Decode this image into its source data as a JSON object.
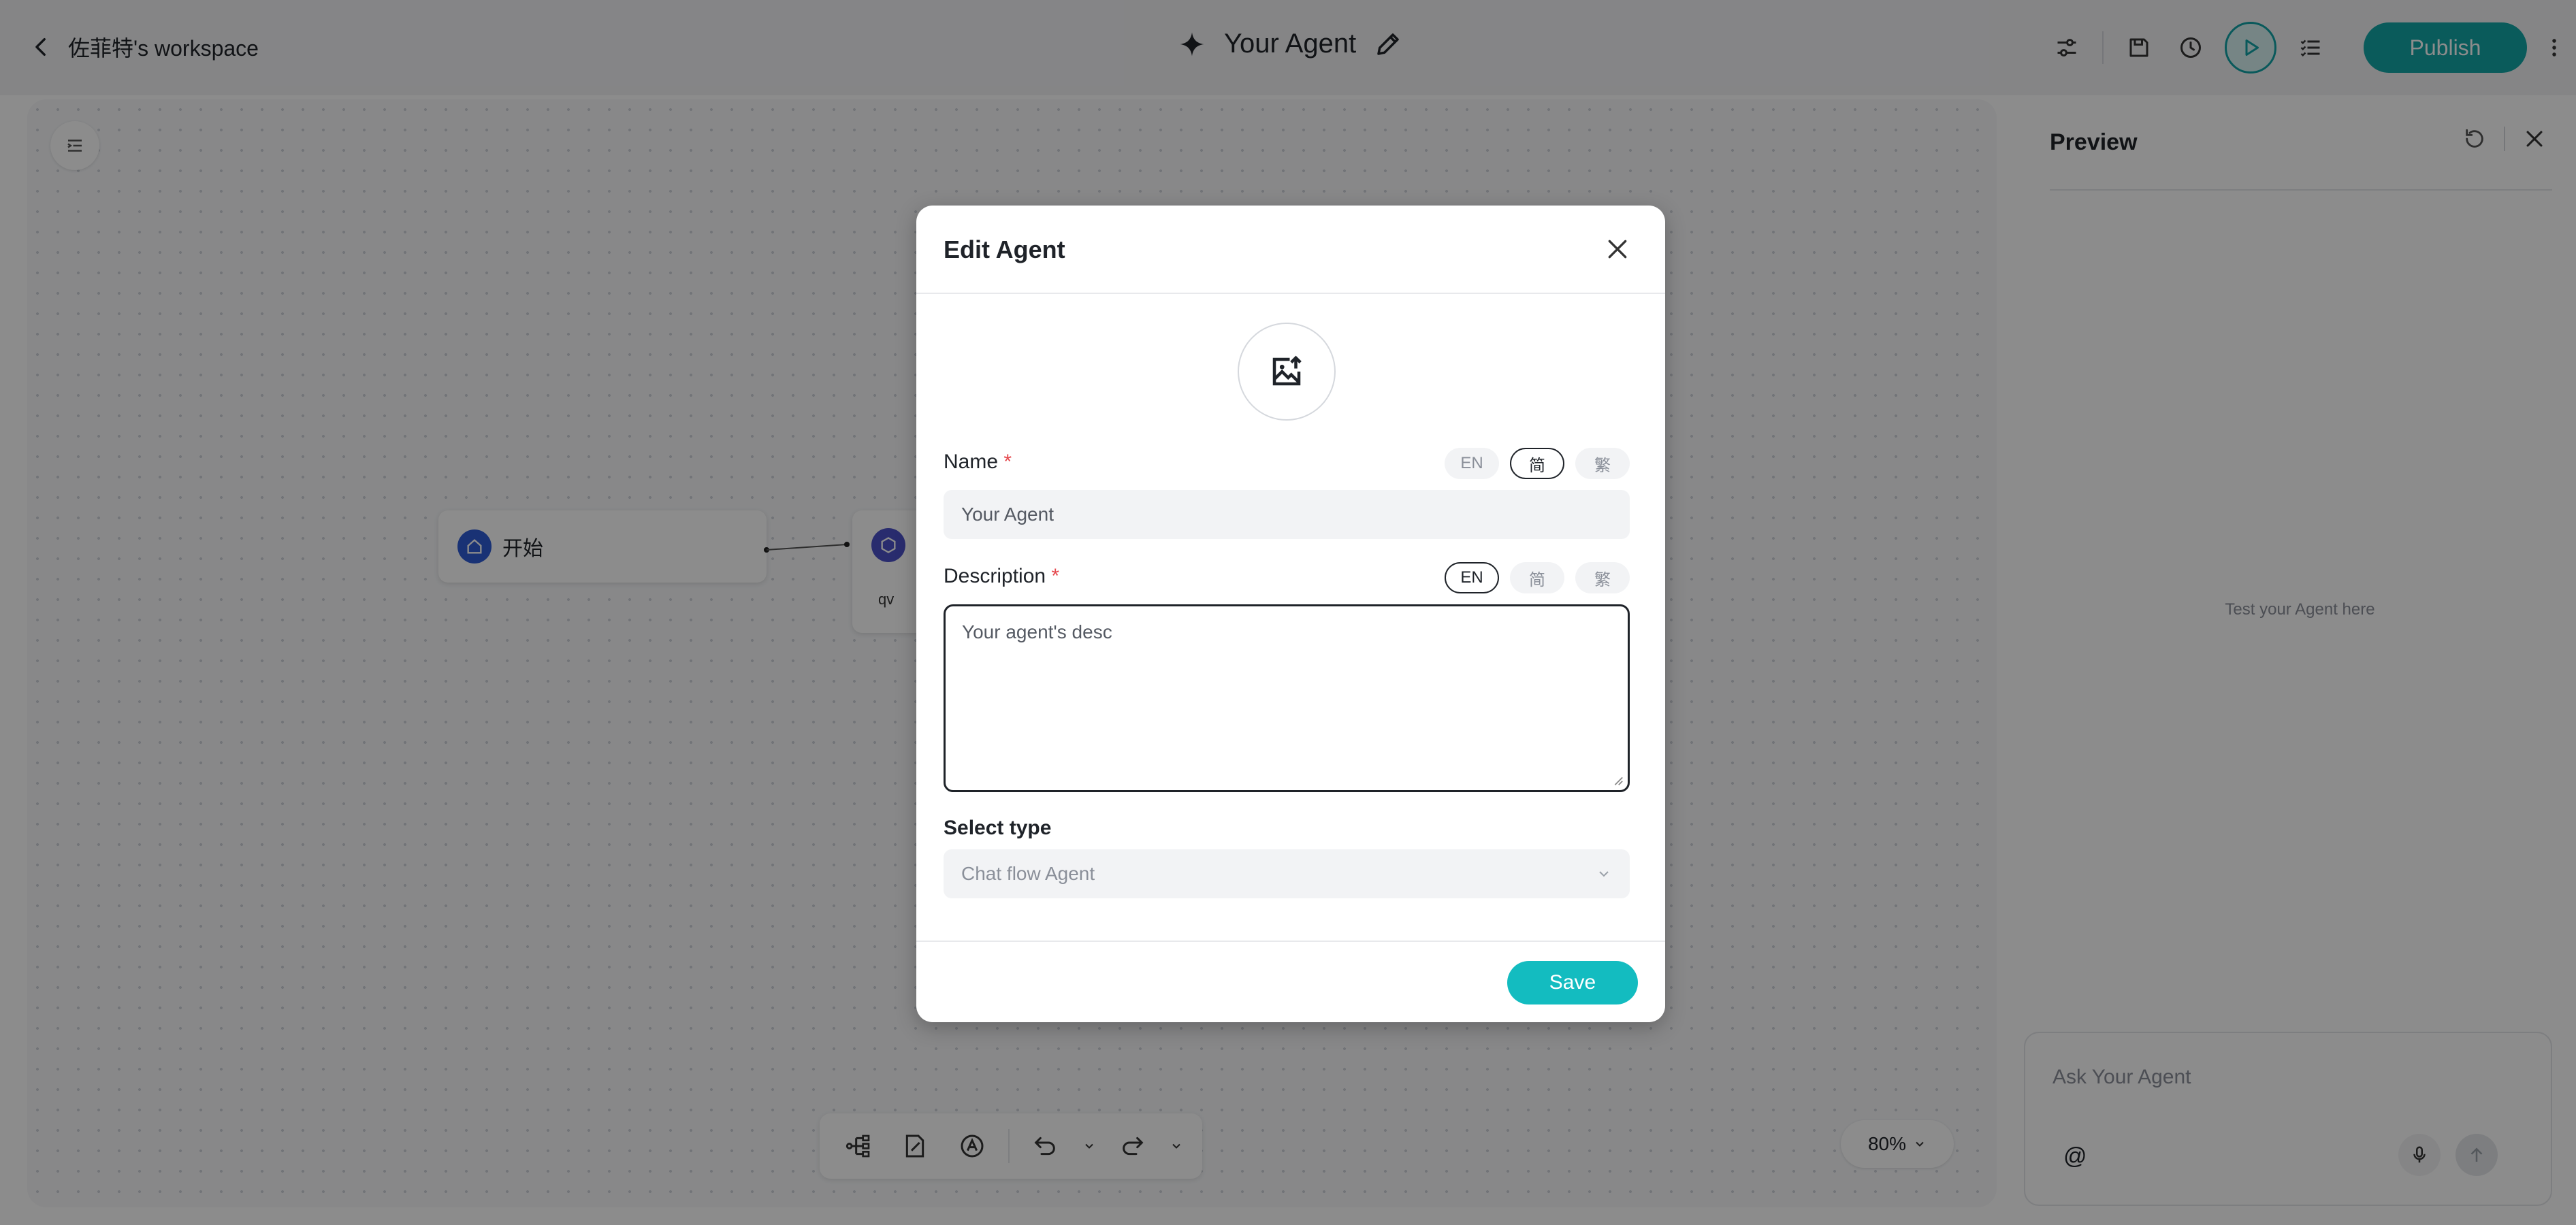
{
  "header": {
    "workspace_label": "佐菲特's workspace",
    "agent_title": "Your Agent",
    "publish_label": "Publish"
  },
  "canvas": {
    "start_node_label": "开始",
    "node2_sub_label": "qv",
    "zoom_label": "80%"
  },
  "preview": {
    "title": "Preview",
    "empty_text": "Test your Agent here",
    "chat_placeholder": "Ask Your Agent",
    "at_symbol": "@"
  },
  "modal": {
    "title": "Edit Agent",
    "name_label": "Name",
    "required_mark": "*",
    "name_value": "Your Agent",
    "description_label": "Description",
    "description_value": "Your agent's desc",
    "lang_options": [
      "EN",
      "简",
      "繁"
    ],
    "name_active_lang": "简",
    "description_active_lang": "EN",
    "select_type_label": "Select type",
    "select_type_value": "Chat flow Agent",
    "save_label": "Save"
  },
  "colors": {
    "accent": "#13a6a6",
    "save_button": "#13bcc0",
    "required": "#e5484d",
    "overlay": "rgba(0,0,0,0.45)"
  }
}
